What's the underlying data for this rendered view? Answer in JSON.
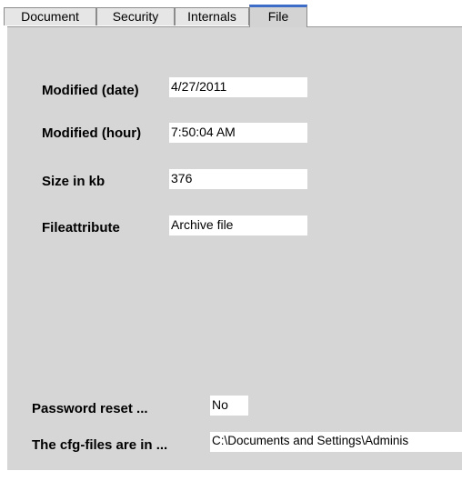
{
  "tabs": [
    {
      "label": "Document"
    },
    {
      "label": "Security"
    },
    {
      "label": "Internals"
    },
    {
      "label": "File",
      "active": true
    }
  ],
  "file": {
    "modified_date_label": "Modified (date)",
    "modified_date_value": "4/27/2011",
    "modified_hour_label": "Modified (hour)",
    "modified_hour_value": "7:50:04 AM",
    "size_label": "Size in kb",
    "size_value": "376",
    "fileattribute_label": "Fileattribute",
    "fileattribute_value": "Archive file"
  },
  "bottom": {
    "password_reset_label": "Password reset ...",
    "password_reset_value": "No",
    "cfg_label": "The cfg-files are in ...",
    "cfg_value": "C:\\Documents and Settings\\Adminis"
  },
  "colors": {
    "panel_bg": "#d6d6d6",
    "active_tab_accent": "#3c6cc8"
  }
}
